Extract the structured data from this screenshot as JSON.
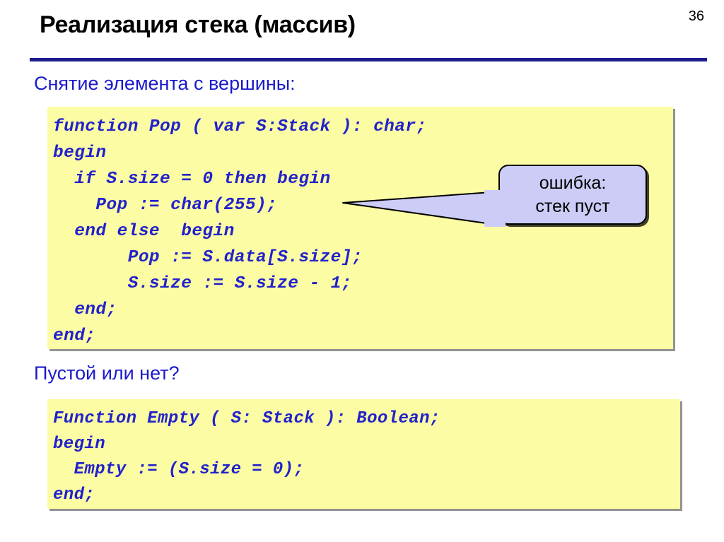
{
  "slide": {
    "page_number": "36",
    "title": "Реализация стека (массив)",
    "rule_color": "#1d1d8f",
    "background": "#ffffff"
  },
  "sections": [
    {
      "caption": "Снятие элемента с вершины:",
      "caption_color": "#1a1acc",
      "code_background": "#fcfca4",
      "code_color": "#2222cc",
      "code": "function Pop ( var S:Stack ): char;\nbegin\n  if S.size = 0 then begin\n    Pop := char(255);\n  end else  begin\n       Pop := S.data[S.size];\n       S.size := S.size - 1;\n  end;\nend;"
    },
    {
      "caption": "Пустой или нет?",
      "caption_color": "#1a1acc",
      "code_background": "#fcfca4",
      "code_color": "#2222cc",
      "code": "Function Empty ( S: Stack ): Boolean;\nbegin\n  Empty := (S.size = 0);\nend;"
    }
  ],
  "callout": {
    "line1": "ошибка:",
    "line2": "стек пуст",
    "fill": "#ccccf7",
    "border": "#000000",
    "text_color": "#000000"
  }
}
